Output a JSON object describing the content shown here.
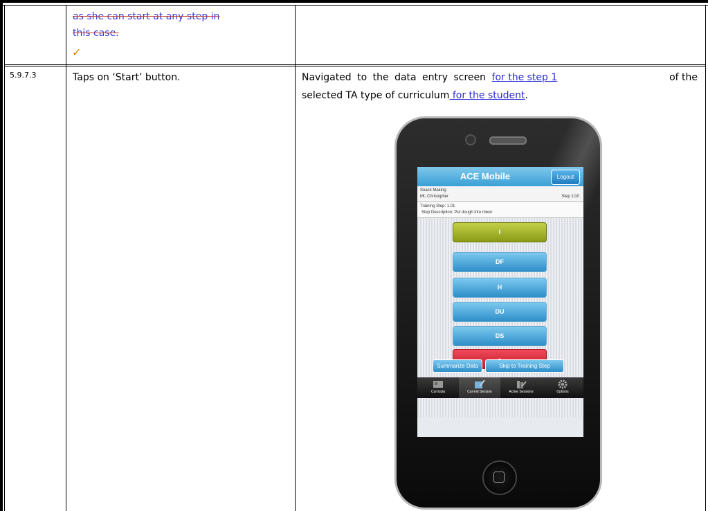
{
  "row_prev": {
    "struck_line1": "as she can start at any step in",
    "struck_line2": "this case.",
    "check_mark": "✓"
  },
  "row_current": {
    "step_id": "5.9.7.3",
    "action": "Taps on ‘Start’ button.",
    "result_part1": "Navigated to the data entry screen ",
    "result_link1": "for the step 1 ",
    "result_part2": "of the",
    "result_part3": "selected TA type of curriculum",
    "result_link2": " for the student",
    "result_end": "."
  },
  "app": {
    "title": "ACE Mobile",
    "logout_label": "Logout",
    "curriculum_name": "Snack Making",
    "student_name": "Mt, Christopher",
    "step_counter": "Step 1/10",
    "training_step": "Training Step: 1.01",
    "step_description": "Step Description: Put dough into mixer",
    "codes": [
      "I",
      "DF",
      "H",
      "DU",
      "DS",
      "-"
    ],
    "summarize_label": "Summarize Data",
    "skip_label": "Skip to Training Step",
    "tabs": [
      "Curricula",
      "Current Session",
      "Active Sessions",
      "Options"
    ]
  },
  "colors": {
    "link": "#2a2ad4",
    "strike_text": "#3a3adf",
    "check": "#e57a00"
  }
}
